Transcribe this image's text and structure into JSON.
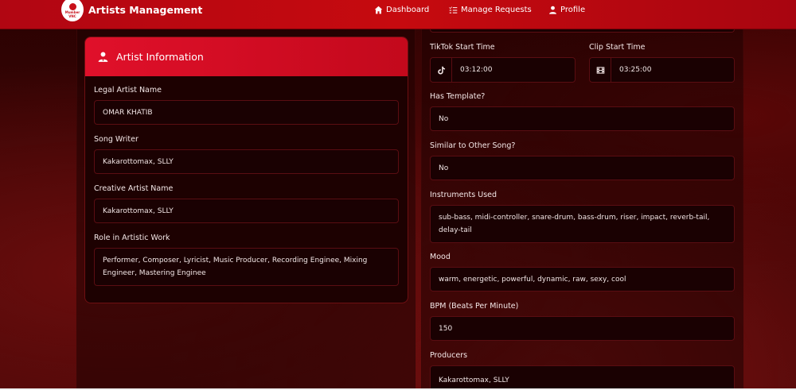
{
  "navbar": {
    "logo_text": "Mumber VNC",
    "brand": "Artists Management",
    "links": [
      {
        "label": "Dashboard",
        "icon": "home-icon"
      },
      {
        "label": "Manage Requests",
        "icon": "list-check-icon"
      },
      {
        "label": "Profile",
        "icon": "user-icon"
      }
    ]
  },
  "artist_card": {
    "title": "Artist Information",
    "icon": "user-tie-icon",
    "fields": {
      "legal_name": {
        "label": "Legal Artist Name",
        "value": "OMAR KHATIB"
      },
      "song_writer": {
        "label": "Song Writer",
        "value": "Kakarottomax, SLLY"
      },
      "creative_name": {
        "label": "Creative Artist Name",
        "value": "Kakarottomax, SLLY"
      },
      "role": {
        "label": "Role in Artistic Work",
        "value": "Performer, Composer, Lyricist, Music Producer, Recording Enginee, Mixing Engineer, Mastering Enginee"
      }
    }
  },
  "song_details": {
    "tiktok_start": {
      "label": "TikTok Start Time",
      "value": "03:12:00",
      "icon": "tiktok-icon"
    },
    "clip_start": {
      "label": "Clip Start Time",
      "value": "03:25:00",
      "icon": "film-icon"
    },
    "has_template": {
      "label": "Has Template?",
      "value": "No"
    },
    "similar": {
      "label": "Similar to Other Song?",
      "value": "No"
    },
    "instruments": {
      "label": "Instruments Used",
      "value": "sub-bass, midi-controller, snare-drum, bass-drum, riser, impact, reverb-tail, delay-tail"
    },
    "mood": {
      "label": "Mood",
      "value": "warm, energetic, powerful, dynamic, raw, sexy, cool"
    },
    "bpm": {
      "label": "BPM (Beats Per Minute)",
      "value": "150"
    },
    "producers": {
      "label": "Producers",
      "value": "Kakarottomax, SLLY"
    }
  },
  "colors": {
    "accent": "#c60a0f",
    "header_gradient_start": "#e0102a",
    "field_border": "#5a0d12"
  }
}
